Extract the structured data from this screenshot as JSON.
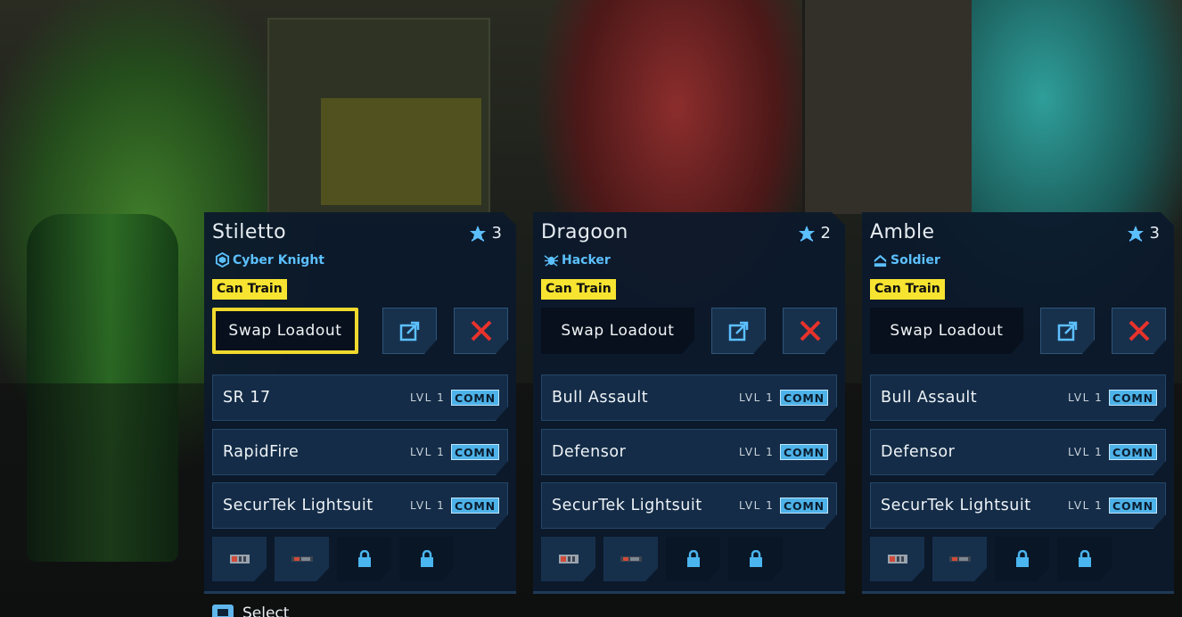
{
  "colors": {
    "panel_bg": "#0c1a2c",
    "accent_blue": "#5cc0ff",
    "badge_yellow": "#f7e431",
    "focus_yellow": "#f0d92d",
    "remove_red": "#e8322b",
    "rarity_blue": "#4db2e8"
  },
  "icons": {
    "rank": "chevron-star-icon",
    "edit": "open-external-icon",
    "remove": "close-x-icon",
    "slot_filled": "grenade-item-icon",
    "slot_filled2": "ammo-item-icon",
    "slot_locked": "locked-slot-icon",
    "select": "controller-button-icon"
  },
  "squad": [
    {
      "name": "Stiletto",
      "rank": "3",
      "class_label": "Cyber Knight",
      "class_icon": "cyber-knight-cube-icon",
      "badge": "Can Train",
      "swap_label": "Swap Loadout",
      "focused": true,
      "items": [
        {
          "name": "SR 17",
          "level": "LVL 1",
          "rarity": "COMN"
        },
        {
          "name": "RapidFire",
          "level": "LVL 1",
          "rarity": "COMN"
        },
        {
          "name": "SecurTek Lightsuit",
          "level": "LVL 1",
          "rarity": "COMN"
        }
      ]
    },
    {
      "name": "Dragoon",
      "rank": "2",
      "class_label": "Hacker",
      "class_icon": "hacker-spider-icon",
      "badge": "Can Train",
      "swap_label": "Swap Loadout",
      "focused": false,
      "items": [
        {
          "name": "Bull Assault",
          "level": "LVL 1",
          "rarity": "COMN"
        },
        {
          "name": "Defensor",
          "level": "LVL 1",
          "rarity": "COMN"
        },
        {
          "name": "SecurTek Lightsuit",
          "level": "LVL 1",
          "rarity": "COMN"
        }
      ]
    },
    {
      "name": "Amble",
      "rank": "3",
      "class_label": "Soldier",
      "class_icon": "soldier-chevron-icon",
      "badge": "Can Train",
      "swap_label": "Swap Loadout",
      "focused": false,
      "items": [
        {
          "name": "Bull Assault",
          "level": "LVL 1",
          "rarity": "COMN"
        },
        {
          "name": "Defensor",
          "level": "LVL 1",
          "rarity": "COMN"
        },
        {
          "name": "SecurTek Lightsuit",
          "level": "LVL 1",
          "rarity": "COMN"
        }
      ]
    }
  ],
  "footer": {
    "select_label": "Select"
  }
}
